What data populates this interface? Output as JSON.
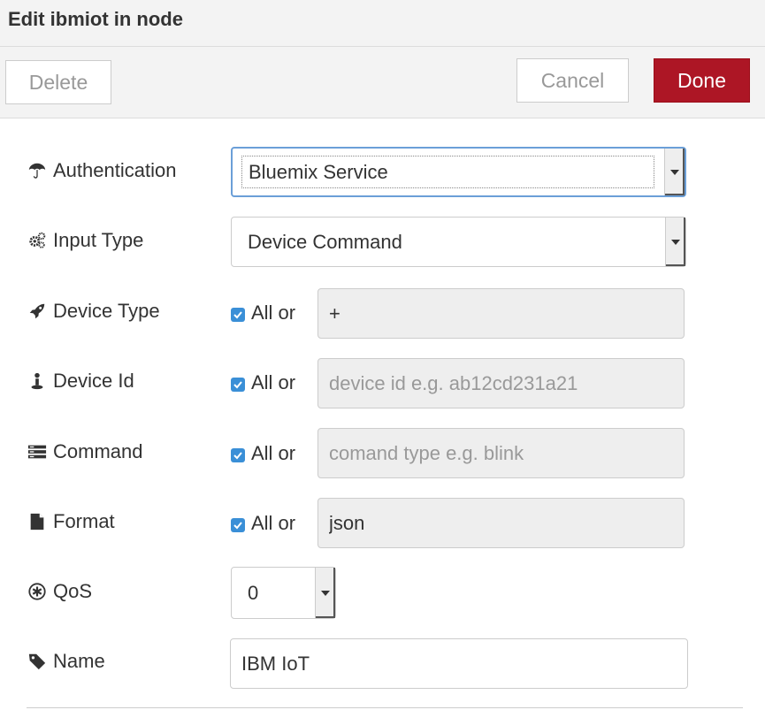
{
  "header": {
    "title": "Edit ibmiot in node"
  },
  "toolbar": {
    "delete_label": "Delete",
    "cancel_label": "Cancel",
    "done_label": "Done",
    "done_color": "#ad1625"
  },
  "form": {
    "authentication": {
      "label": "Authentication",
      "icon": "umbrella-icon",
      "value": "Bluemix Service"
    },
    "input_type": {
      "label": "Input Type",
      "icon": "cogs-icon",
      "value": "Device Command"
    },
    "device_type": {
      "label": "Device Type",
      "icon": "rocket-icon",
      "all_label": "All or",
      "all_checked": true,
      "value": "+",
      "placeholder": ""
    },
    "device_id": {
      "label": "Device Id",
      "icon": "user-icon",
      "all_label": "All or",
      "all_checked": true,
      "value": "",
      "placeholder": "device id e.g. ab12cd231a21"
    },
    "command": {
      "label": "Command",
      "icon": "list-icon",
      "all_label": "All or",
      "all_checked": true,
      "value": "",
      "placeholder": "comand type e.g. blink"
    },
    "format": {
      "label": "Format",
      "icon": "file-icon",
      "all_label": "All or",
      "all_checked": true,
      "value": "json",
      "placeholder": ""
    },
    "qos": {
      "label": "QoS",
      "icon": "asterisk-circle-icon",
      "value": "0"
    },
    "name": {
      "label": "Name",
      "icon": "tag-icon",
      "value": "IBM IoT"
    }
  }
}
